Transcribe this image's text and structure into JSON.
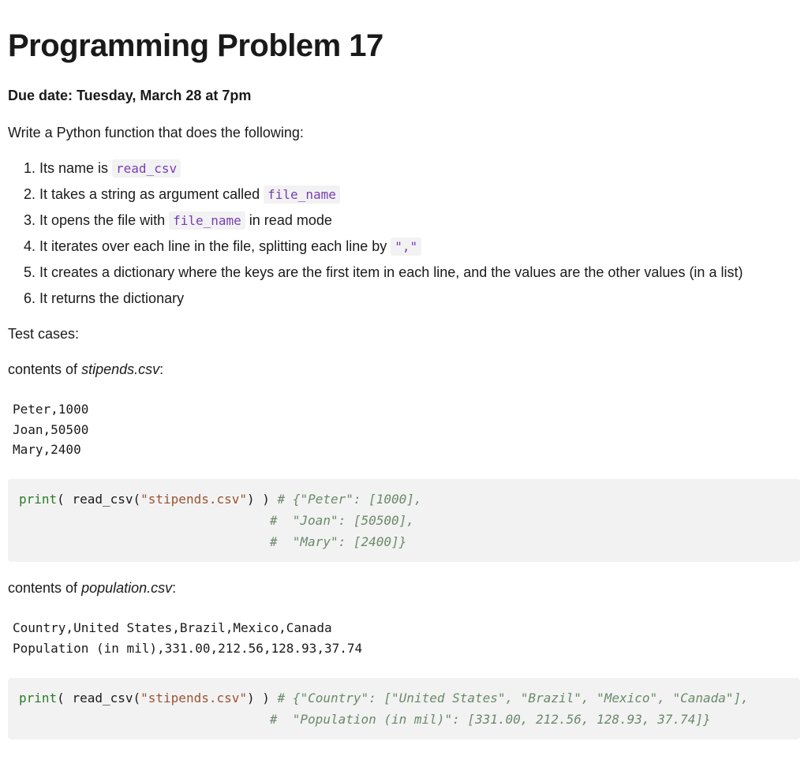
{
  "title": "Programming Problem 17",
  "due_date": "Due date: Tuesday, March 28 at 7pm",
  "intro": "Write a Python function that does the following:",
  "steps": {
    "s1_a": "Its name is ",
    "s1_code": "read_csv",
    "s2_a": "It takes a string as argument called ",
    "s2_code": "file_name",
    "s3_a": "It opens the file with ",
    "s3_code": "file_name",
    "s3_b": " in read mode",
    "s4_a": "It iterates over each line in the file, splitting each line by ",
    "s4_code": "\",\"",
    "s5": "It creates a dictionary where the keys are the first item in each line, and the values are the other values (in a list)",
    "s6": "It returns the dictionary"
  },
  "test_cases_label": "Test cases:",
  "file1": {
    "label_pre": "contents of ",
    "name": "stipends.csv",
    "label_post": ":",
    "contents": "Peter,1000\nJoan,50500\nMary,2400"
  },
  "code1": {
    "print": "print",
    "open_paren": "( ",
    "func": "read_csv",
    "args_open": "(",
    "string": "\"stipends.csv\"",
    "args_close": ")",
    "close_paren": " ) ",
    "comment_l1": "# {\"Peter\": [1000],",
    "comment_l2": "                                 #  \"Joan\": [50500],",
    "comment_l3": "                                 #  \"Mary\": [2400]}"
  },
  "file2": {
    "label_pre": "contents of ",
    "name": "population.csv",
    "label_post": ":",
    "contents": "Country,United States,Brazil,Mexico,Canada\nPopulation (in mil),331.00,212.56,128.93,37.74"
  },
  "code2": {
    "print": "print",
    "open_paren": "( ",
    "func": "read_csv",
    "args_open": "(",
    "string": "\"stipends.csv\"",
    "args_close": ")",
    "close_paren": " ) ",
    "comment_l1": "# {\"Country\": [\"United States\", \"Brazil\", \"Mexico\", \"Canada\"],",
    "comment_l2": "                                 #  \"Population (in mil)\": [331.00, 212.56, 128.93, 37.74]}"
  }
}
